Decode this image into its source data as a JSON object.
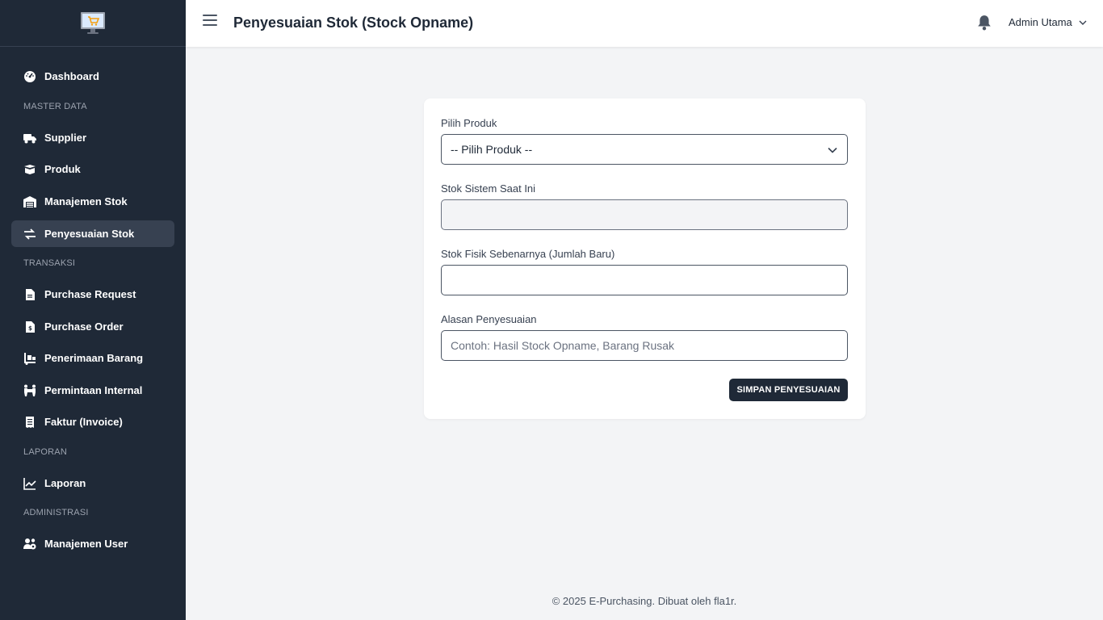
{
  "sidebar": {
    "items": {
      "dashboard": "Dashboard",
      "supplier": "Supplier",
      "produk": "Produk",
      "manajemen_stok": "Manajemen Stok",
      "penyesuaian_stok": "Penyesuaian Stok",
      "purchase_request": "Purchase Request",
      "purchase_order": "Purchase Order",
      "penerimaan_barang": "Penerimaan Barang",
      "permintaan_internal": "Permintaan Internal",
      "faktur": "Faktur (Invoice)",
      "laporan": "Laporan",
      "manajemen_user": "Manajemen User"
    },
    "sections": {
      "master": "MASTER DATA",
      "transaksi": "TRANSAKSI",
      "laporan": "LAPORAN",
      "administrasi": "ADMINISTRASI"
    },
    "active_item": "penyesuaian_stok"
  },
  "header": {
    "title": "Penyesuaian Stok (Stock Opname)",
    "user": "Admin Utama"
  },
  "form": {
    "product_label": "Pilih Produk",
    "product_value": "-- Pilih Produk --",
    "system_stock_label": "Stok Sistem Saat Ini",
    "system_stock_value": "",
    "physical_stock_label": "Stok Fisik Sebenarnya (Jumlah Baru)",
    "physical_stock_value": "",
    "reason_label": "Alasan Penyesuaian",
    "reason_placeholder": "Contoh: Hasil Stock Opname, Barang Rusak",
    "submit_label": "SIMPAN PENYESUAIAN"
  },
  "footer": {
    "text": "© 2025 E-Purchasing. Dibuat oleh fla1r."
  },
  "colors": {
    "sidebar_bg": "#1f2937",
    "active_item_bg": "#374151",
    "page_bg": "#f3f4f6",
    "primary_button": "#1f2937"
  }
}
